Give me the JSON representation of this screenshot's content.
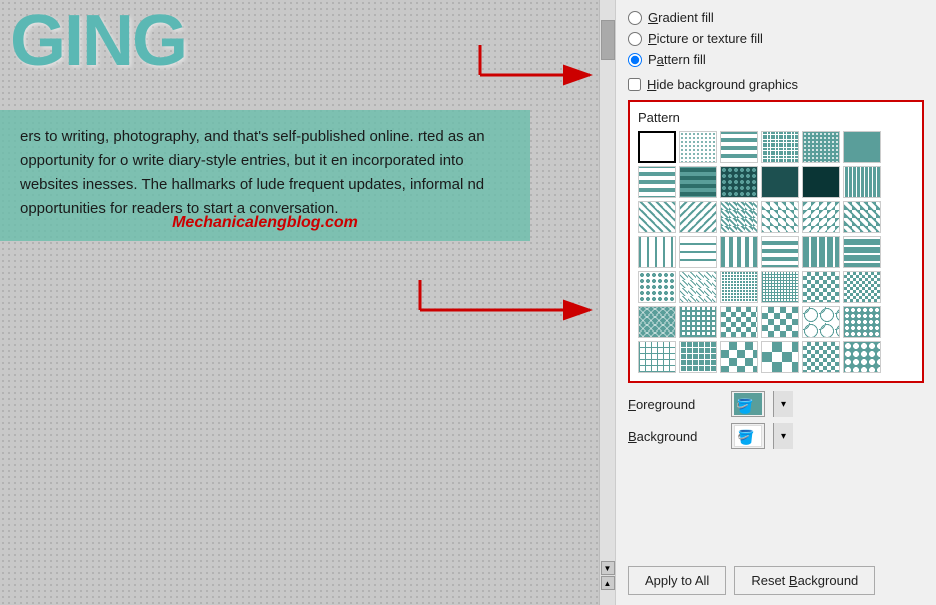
{
  "slide": {
    "title": "GING",
    "content": "ers to writing, photography, and that's self-published online. rted as an opportunity for o write diary-style entries, but it en incorporated into websites inesses. The hallmarks of lude frequent updates, informal nd opportunities for readers to start a conversation.",
    "watermark": "Mechanicalengblog.com"
  },
  "panel": {
    "fill_options": [
      {
        "id": "gradient_fill",
        "label": "Gradient fill",
        "underline_char": "G",
        "checked": false
      },
      {
        "id": "picture_texture_fill",
        "label": "Picture or texture fill",
        "underline_char": "P",
        "checked": false
      },
      {
        "id": "pattern_fill",
        "label": "Pattern fill",
        "underline_char": "a",
        "checked": true
      }
    ],
    "hide_background": {
      "label": "Hide background graphics",
      "underline_char": "H",
      "checked": false
    },
    "pattern_section_label": "Pattern",
    "foreground_label": "Foreground",
    "background_label": "Background",
    "buttons": {
      "apply_to_all": "Apply to All",
      "reset_background": "Reset Background"
    }
  }
}
